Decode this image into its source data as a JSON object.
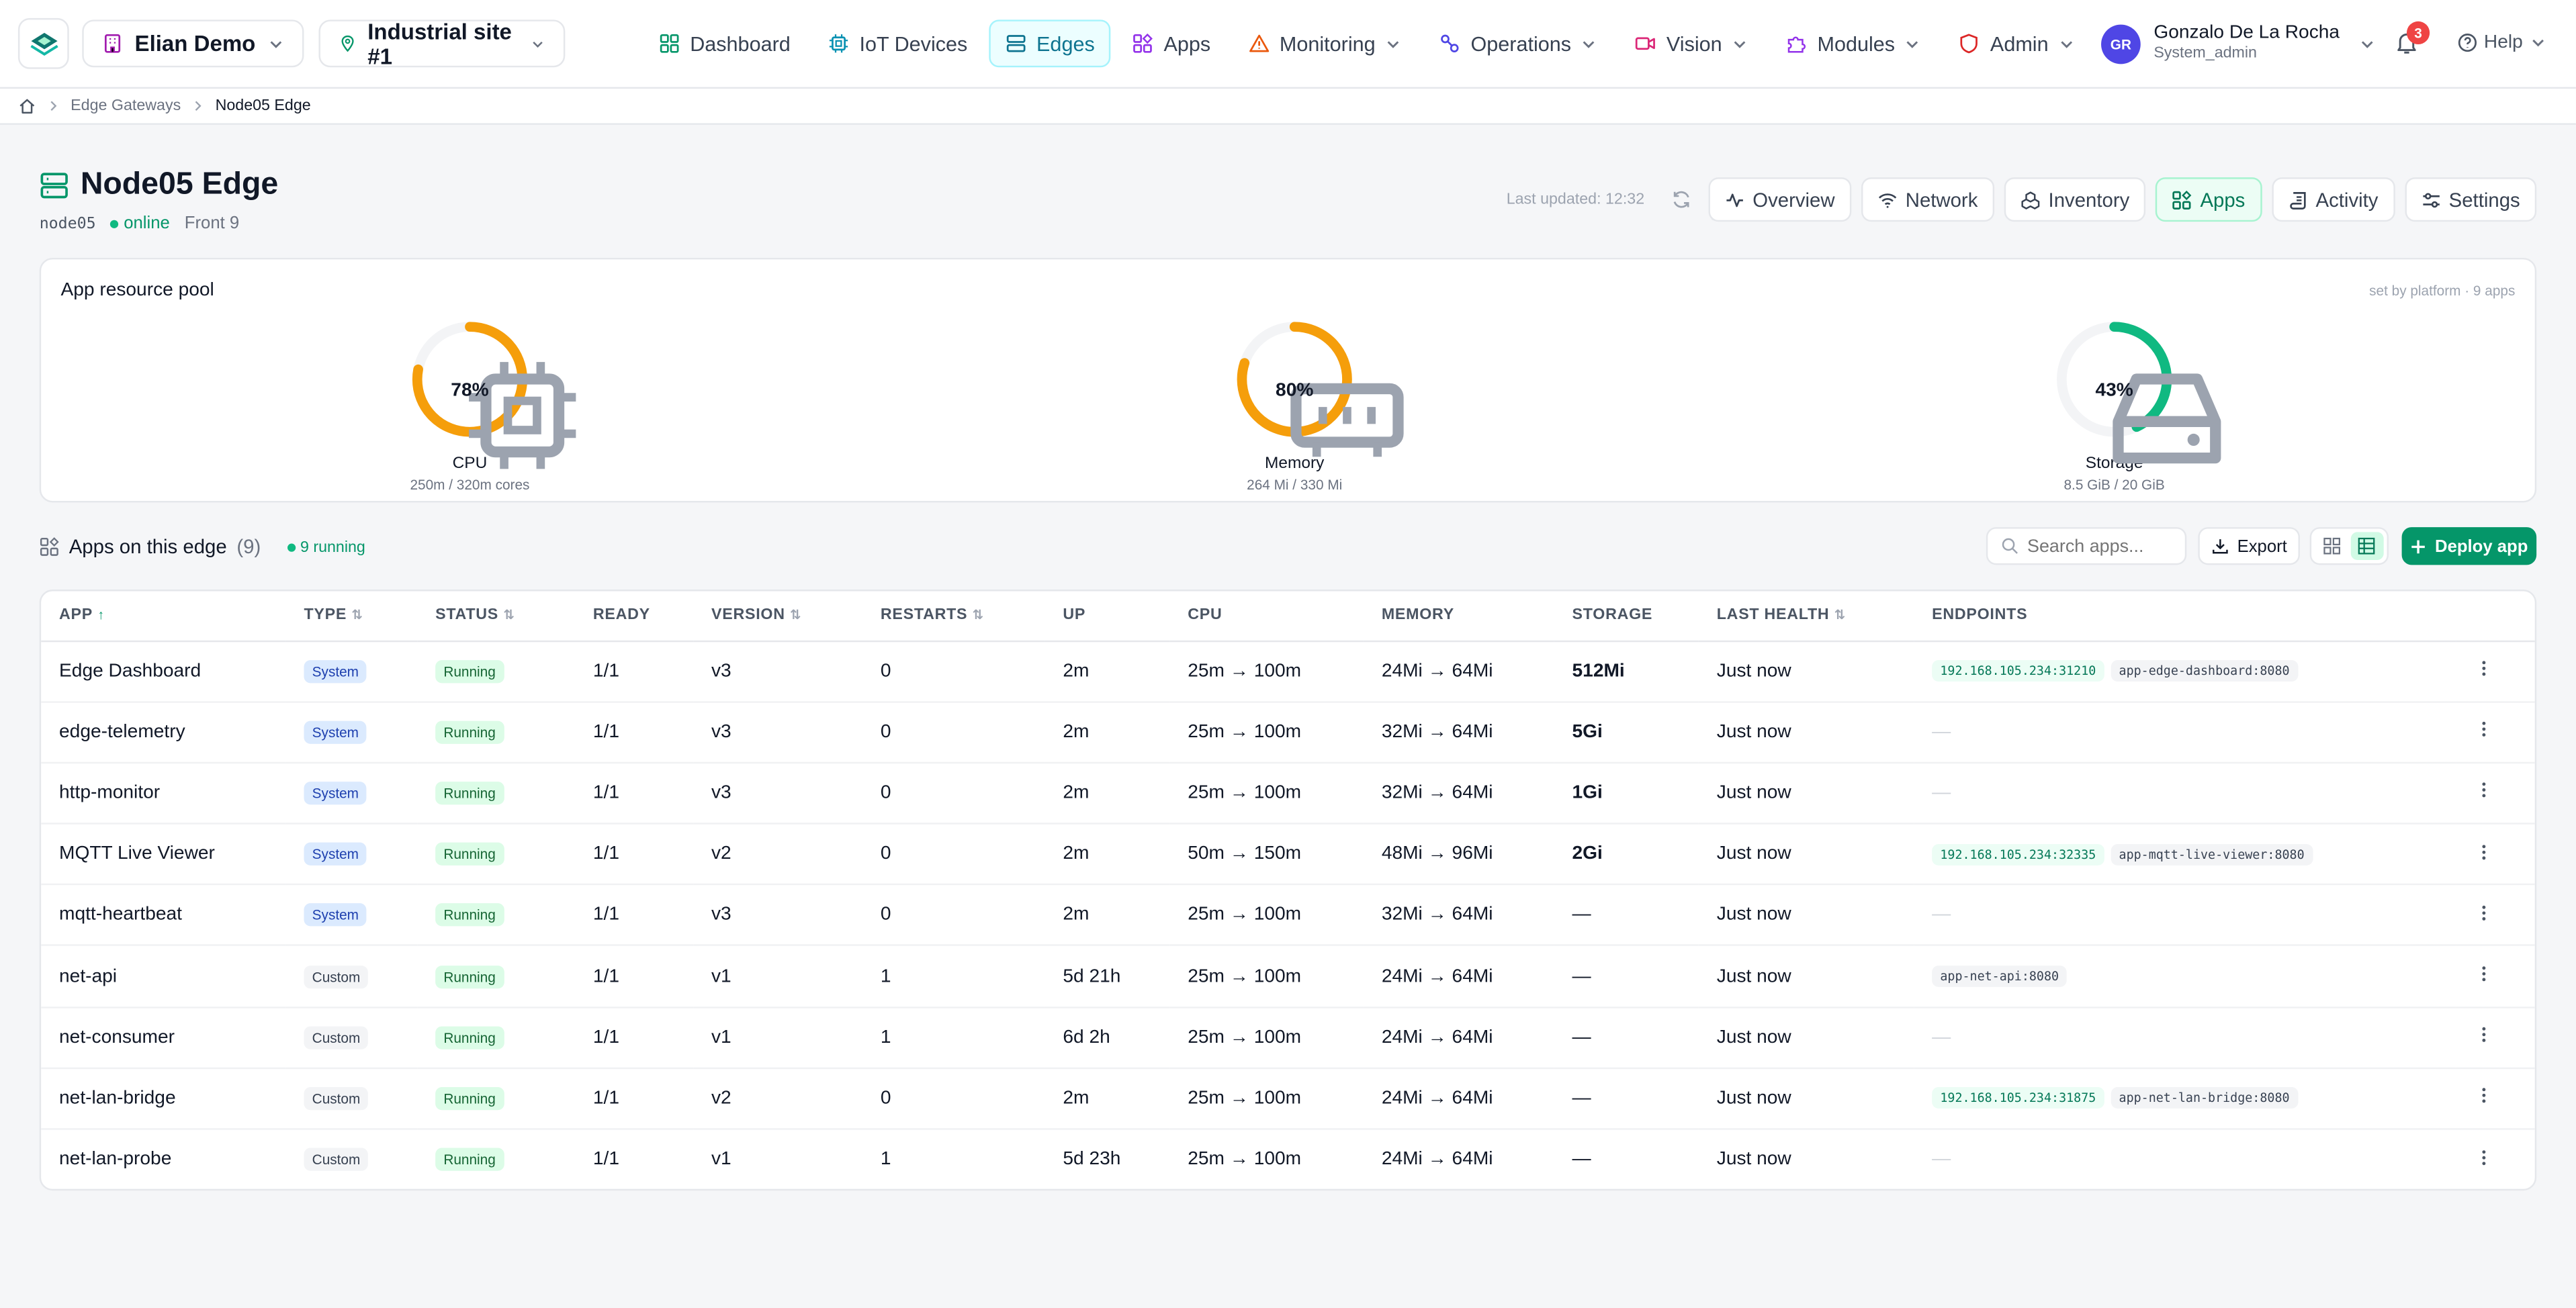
{
  "org": {
    "name": "Elian Demo"
  },
  "site": {
    "name": "Industrial site #1"
  },
  "nav": [
    {
      "label": "Dashboard"
    },
    {
      "label": "IoT Devices"
    },
    {
      "label": "Edges"
    },
    {
      "label": "Apps"
    },
    {
      "label": "Monitoring"
    },
    {
      "label": "Operations"
    },
    {
      "label": "Vision"
    },
    {
      "label": "Modules"
    },
    {
      "label": "Admin"
    }
  ],
  "user": {
    "initials": "GR",
    "name": "Gonzalo De La Rocha",
    "role": "System_admin"
  },
  "notifications": {
    "count": "3"
  },
  "help": {
    "label": "Help"
  },
  "breadcrumb": {
    "parent": "Edge Gateways",
    "current": "Node05 Edge"
  },
  "node": {
    "title": "Node05 Edge",
    "id": "node05",
    "status": "online",
    "location": "Front 9"
  },
  "last_updated": "Last updated: 12:32",
  "tabs": [
    {
      "label": "Overview"
    },
    {
      "label": "Network"
    },
    {
      "label": "Inventory"
    },
    {
      "label": "Apps"
    },
    {
      "label": "Activity"
    },
    {
      "label": "Settings"
    }
  ],
  "pool": {
    "title": "App resource pool",
    "meta": "set by platform · 9 apps",
    "gauges": [
      {
        "label": "CPU",
        "pct": "78%",
        "value": 0.78,
        "sub": "250m / 320m cores",
        "color": "#f59e0b"
      },
      {
        "label": "Memory",
        "pct": "80%",
        "value": 0.8,
        "sub": "264 Mi / 330 Mi",
        "color": "#f59e0b"
      },
      {
        "label": "Storage",
        "pct": "43%",
        "value": 0.43,
        "sub": "8.5 GiB / 20 GiB",
        "color": "#10b981"
      }
    ]
  },
  "apps_bar": {
    "title": "Apps on this edge",
    "count": "(9)",
    "running": "9 running",
    "search_placeholder": "Search apps...",
    "export": "Export",
    "deploy": "Deploy app"
  },
  "table": {
    "headers": [
      "APP",
      "TYPE",
      "STATUS",
      "READY",
      "VERSION",
      "RESTARTS",
      "UP",
      "CPU",
      "MEMORY",
      "STORAGE",
      "LAST HEALTH",
      "ENDPOINTS"
    ],
    "rows": [
      {
        "app": "Edge Dashboard",
        "type": "System",
        "status": "Running",
        "ready": "1/1",
        "version": "v3",
        "restarts": "0",
        "up": "2m",
        "cpu": "25m → 100m",
        "memory": "24Mi → 64Mi",
        "storage": "512Mi",
        "health": "Just now",
        "endpoints": [
          {
            "text": "192.168.105.234:31210",
            "kind": "green"
          },
          {
            "text": "app-edge-dashboard:8080",
            "kind": "gray"
          }
        ]
      },
      {
        "app": "edge-telemetry",
        "type": "System",
        "status": "Running",
        "ready": "1/1",
        "version": "v3",
        "restarts": "0",
        "up": "2m",
        "cpu": "25m → 100m",
        "memory": "32Mi → 64Mi",
        "storage": "5Gi",
        "health": "Just now",
        "endpoints": []
      },
      {
        "app": "http-monitor",
        "type": "System",
        "status": "Running",
        "ready": "1/1",
        "version": "v3",
        "restarts": "0",
        "up": "2m",
        "cpu": "25m → 100m",
        "memory": "32Mi → 64Mi",
        "storage": "1Gi",
        "health": "Just now",
        "endpoints": []
      },
      {
        "app": "MQTT Live Viewer",
        "type": "System",
        "status": "Running",
        "ready": "1/1",
        "version": "v2",
        "restarts": "0",
        "up": "2m",
        "cpu": "50m → 150m",
        "memory": "48Mi → 96Mi",
        "storage": "2Gi",
        "health": "Just now",
        "endpoints": [
          {
            "text": "192.168.105.234:32335",
            "kind": "green"
          },
          {
            "text": "app-mqtt-live-viewer:8080",
            "kind": "gray"
          }
        ]
      },
      {
        "app": "mqtt-heartbeat",
        "type": "System",
        "status": "Running",
        "ready": "1/1",
        "version": "v3",
        "restarts": "0",
        "up": "2m",
        "cpu": "25m → 100m",
        "memory": "32Mi → 64Mi",
        "storage": "—",
        "health": "Just now",
        "endpoints": []
      },
      {
        "app": "net-api",
        "type": "Custom",
        "status": "Running",
        "ready": "1/1",
        "version": "v1",
        "restarts": "1",
        "up": "5d 21h",
        "cpu": "25m → 100m",
        "memory": "24Mi → 64Mi",
        "storage": "—",
        "health": "Just now",
        "endpoints": [
          {
            "text": "app-net-api:8080",
            "kind": "gray"
          }
        ]
      },
      {
        "app": "net-consumer",
        "type": "Custom",
        "status": "Running",
        "ready": "1/1",
        "version": "v1",
        "restarts": "1",
        "up": "6d 2h",
        "cpu": "25m → 100m",
        "memory": "24Mi → 64Mi",
        "storage": "—",
        "health": "Just now",
        "endpoints": []
      },
      {
        "app": "net-lan-bridge",
        "type": "Custom",
        "status": "Running",
        "ready": "1/1",
        "version": "v2",
        "restarts": "0",
        "up": "2m",
        "cpu": "25m → 100m",
        "memory": "24Mi → 64Mi",
        "storage": "—",
        "health": "Just now",
        "endpoints": [
          {
            "text": "192.168.105.234:31875",
            "kind": "green"
          },
          {
            "text": "app-net-lan-bridge:8080",
            "kind": "gray"
          }
        ]
      },
      {
        "app": "net-lan-probe",
        "type": "Custom",
        "status": "Running",
        "ready": "1/1",
        "version": "v1",
        "restarts": "1",
        "up": "5d 23h",
        "cpu": "25m → 100m",
        "memory": "24Mi → 64Mi",
        "storage": "—",
        "health": "Just now",
        "endpoints": []
      }
    ]
  },
  "colors": {
    "accent": "#059669",
    "nav_active": "#0e7490",
    "warning": "#f59e0b",
    "danger": "#ef4444"
  }
}
